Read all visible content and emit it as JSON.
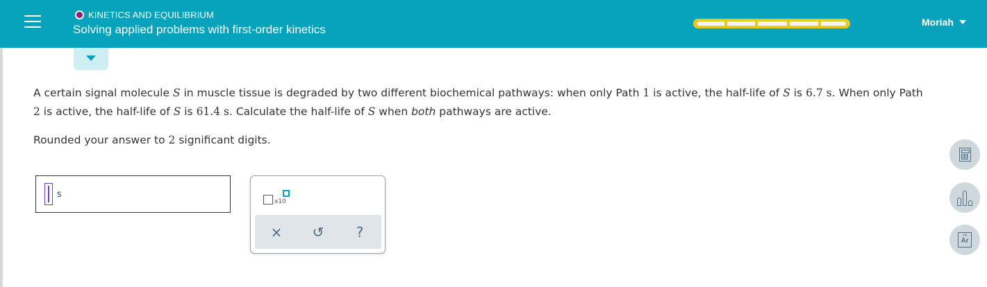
{
  "header": {
    "topic": "KINETICS AND EQUILIBRIUM",
    "title": "Solving applied problems with first-order kinetics",
    "user_name": "Moriah",
    "progress_segments": 5,
    "progress_filled": 0,
    "accent_color": "#07a3bd",
    "progress_color": "#e8c91d",
    "topic_dot_color": "#8a1c7c"
  },
  "question": {
    "p1": "A certain signal molecule ",
    "var": "S",
    "p2": " in muscle tissue is degraded by two different biochemical pathways: when only Path ",
    "path1": "1",
    "p3": " is active, the half-life of ",
    "p4": " is ",
    "value1": "6.7 s",
    "p5": ". When only Path ",
    "path2": "2",
    "p6": " is active, the half-life of ",
    "p7": " is ",
    "value2": "61.4 s",
    "p8": ". Calculate the half-life of ",
    "p9": " when ",
    "both": "both",
    "p10": " pathways are active."
  },
  "instruction": {
    "text1": "Rounded your answer to ",
    "digits": "2",
    "text2": " significant digits."
  },
  "answer": {
    "value": "",
    "unit": "s"
  },
  "palette": {
    "sci_notation_label": "x10",
    "clear_symbol": "×",
    "undo_symbol": "↺",
    "help_symbol": "?"
  },
  "side_tools": {
    "calculator_icon": "calculator-icon",
    "chart_icon": "bar-chart-icon",
    "periodic_number": "18",
    "periodic_symbol": "Ar"
  }
}
